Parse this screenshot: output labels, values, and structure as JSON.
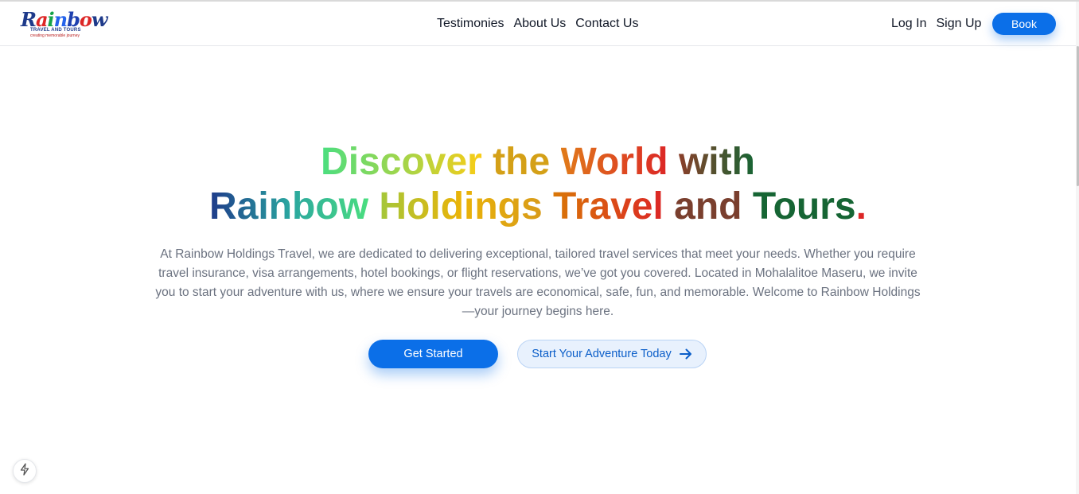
{
  "logo": {
    "word_letters": [
      "R",
      "a",
      "i",
      "n",
      "b",
      "o",
      "w"
    ],
    "letter_colors": [
      "#1e3a8a",
      "#dc2626",
      "#16a34a",
      "#2563eb",
      "#1e40af",
      "#dc2626",
      "#1e3a8a"
    ],
    "subtitle": "TRAVEL AND TOURS",
    "tagline": "creating memorable journey"
  },
  "nav": {
    "links": [
      "Testimonies",
      "About Us",
      "Contact Us"
    ],
    "login": "Log In",
    "signup": "Sign Up",
    "book": "Book"
  },
  "hero": {
    "title_line1": [
      "Discover",
      "the",
      "World",
      "with"
    ],
    "title_line2": [
      "Rainbow",
      "Holdings",
      "Travel",
      "and",
      "Tours",
      "."
    ],
    "description": "At Rainbow Holdings Travel, we are dedicated to delivering exceptional, tailored travel services that meet your needs. Whether you require travel insurance, visa arrangements, hotel bookings, or flight reservations, we’ve got you covered. Located in Mohalalitoe Maseru, we invite you to start your adventure with us, where we ensure your travels are economical, safe, fun, and memorable. Welcome to Rainbow Holdings —your journey begins here.",
    "primary_cta": "Get Started",
    "secondary_cta": "Start Your Adventure Today"
  },
  "icons": {
    "secondary_cta_icon": "arrow-right-icon",
    "badge_icon": "bolt-icon"
  },
  "colors": {
    "accent": "#0b6fe8",
    "secondary_bg": "#e8f1fd",
    "text_muted": "#6b7280"
  }
}
